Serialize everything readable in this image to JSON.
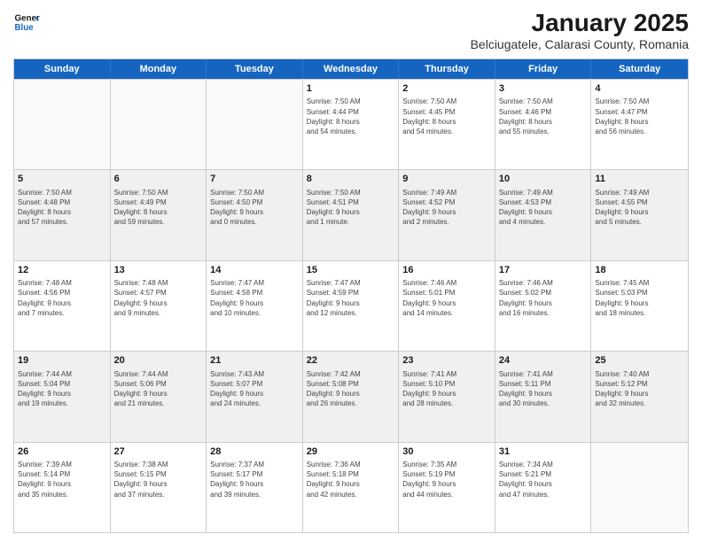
{
  "header": {
    "logo_line1": "General",
    "logo_line2": "Blue",
    "month_title": "January 2025",
    "subtitle": "Belciugatele, Calarasi County, Romania"
  },
  "weekdays": [
    "Sunday",
    "Monday",
    "Tuesday",
    "Wednesday",
    "Thursday",
    "Friday",
    "Saturday"
  ],
  "weeks": [
    [
      {
        "day": "",
        "info": ""
      },
      {
        "day": "",
        "info": ""
      },
      {
        "day": "",
        "info": ""
      },
      {
        "day": "1",
        "info": "Sunrise: 7:50 AM\nSunset: 4:44 PM\nDaylight: 8 hours\nand 54 minutes."
      },
      {
        "day": "2",
        "info": "Sunrise: 7:50 AM\nSunset: 4:45 PM\nDaylight: 8 hours\nand 54 minutes."
      },
      {
        "day": "3",
        "info": "Sunrise: 7:50 AM\nSunset: 4:46 PM\nDaylight: 8 hours\nand 55 minutes."
      },
      {
        "day": "4",
        "info": "Sunrise: 7:50 AM\nSunset: 4:47 PM\nDaylight: 8 hours\nand 56 minutes."
      }
    ],
    [
      {
        "day": "5",
        "info": "Sunrise: 7:50 AM\nSunset: 4:48 PM\nDaylight: 8 hours\nand 57 minutes."
      },
      {
        "day": "6",
        "info": "Sunrise: 7:50 AM\nSunset: 4:49 PM\nDaylight: 8 hours\nand 59 minutes."
      },
      {
        "day": "7",
        "info": "Sunrise: 7:50 AM\nSunset: 4:50 PM\nDaylight: 9 hours\nand 0 minutes."
      },
      {
        "day": "8",
        "info": "Sunrise: 7:50 AM\nSunset: 4:51 PM\nDaylight: 9 hours\nand 1 minute."
      },
      {
        "day": "9",
        "info": "Sunrise: 7:49 AM\nSunset: 4:52 PM\nDaylight: 9 hours\nand 2 minutes."
      },
      {
        "day": "10",
        "info": "Sunrise: 7:49 AM\nSunset: 4:53 PM\nDaylight: 9 hours\nand 4 minutes."
      },
      {
        "day": "11",
        "info": "Sunrise: 7:49 AM\nSunset: 4:55 PM\nDaylight: 9 hours\nand 5 minutes."
      }
    ],
    [
      {
        "day": "12",
        "info": "Sunrise: 7:48 AM\nSunset: 4:56 PM\nDaylight: 9 hours\nand 7 minutes."
      },
      {
        "day": "13",
        "info": "Sunrise: 7:48 AM\nSunset: 4:57 PM\nDaylight: 9 hours\nand 9 minutes."
      },
      {
        "day": "14",
        "info": "Sunrise: 7:47 AM\nSunset: 4:58 PM\nDaylight: 9 hours\nand 10 minutes."
      },
      {
        "day": "15",
        "info": "Sunrise: 7:47 AM\nSunset: 4:59 PM\nDaylight: 9 hours\nand 12 minutes."
      },
      {
        "day": "16",
        "info": "Sunrise: 7:46 AM\nSunset: 5:01 PM\nDaylight: 9 hours\nand 14 minutes."
      },
      {
        "day": "17",
        "info": "Sunrise: 7:46 AM\nSunset: 5:02 PM\nDaylight: 9 hours\nand 16 minutes."
      },
      {
        "day": "18",
        "info": "Sunrise: 7:45 AM\nSunset: 5:03 PM\nDaylight: 9 hours\nand 18 minutes."
      }
    ],
    [
      {
        "day": "19",
        "info": "Sunrise: 7:44 AM\nSunset: 5:04 PM\nDaylight: 9 hours\nand 19 minutes."
      },
      {
        "day": "20",
        "info": "Sunrise: 7:44 AM\nSunset: 5:06 PM\nDaylight: 9 hours\nand 21 minutes."
      },
      {
        "day": "21",
        "info": "Sunrise: 7:43 AM\nSunset: 5:07 PM\nDaylight: 9 hours\nand 24 minutes."
      },
      {
        "day": "22",
        "info": "Sunrise: 7:42 AM\nSunset: 5:08 PM\nDaylight: 9 hours\nand 26 minutes."
      },
      {
        "day": "23",
        "info": "Sunrise: 7:41 AM\nSunset: 5:10 PM\nDaylight: 9 hours\nand 28 minutes."
      },
      {
        "day": "24",
        "info": "Sunrise: 7:41 AM\nSunset: 5:11 PM\nDaylight: 9 hours\nand 30 minutes."
      },
      {
        "day": "25",
        "info": "Sunrise: 7:40 AM\nSunset: 5:12 PM\nDaylight: 9 hours\nand 32 minutes."
      }
    ],
    [
      {
        "day": "26",
        "info": "Sunrise: 7:39 AM\nSunset: 5:14 PM\nDaylight: 9 hours\nand 35 minutes."
      },
      {
        "day": "27",
        "info": "Sunrise: 7:38 AM\nSunset: 5:15 PM\nDaylight: 9 hours\nand 37 minutes."
      },
      {
        "day": "28",
        "info": "Sunrise: 7:37 AM\nSunset: 5:17 PM\nDaylight: 9 hours\nand 39 minutes."
      },
      {
        "day": "29",
        "info": "Sunrise: 7:36 AM\nSunset: 5:18 PM\nDaylight: 9 hours\nand 42 minutes."
      },
      {
        "day": "30",
        "info": "Sunrise: 7:35 AM\nSunset: 5:19 PM\nDaylight: 9 hours\nand 44 minutes."
      },
      {
        "day": "31",
        "info": "Sunrise: 7:34 AM\nSunset: 5:21 PM\nDaylight: 9 hours\nand 47 minutes."
      },
      {
        "day": "",
        "info": ""
      }
    ]
  ]
}
